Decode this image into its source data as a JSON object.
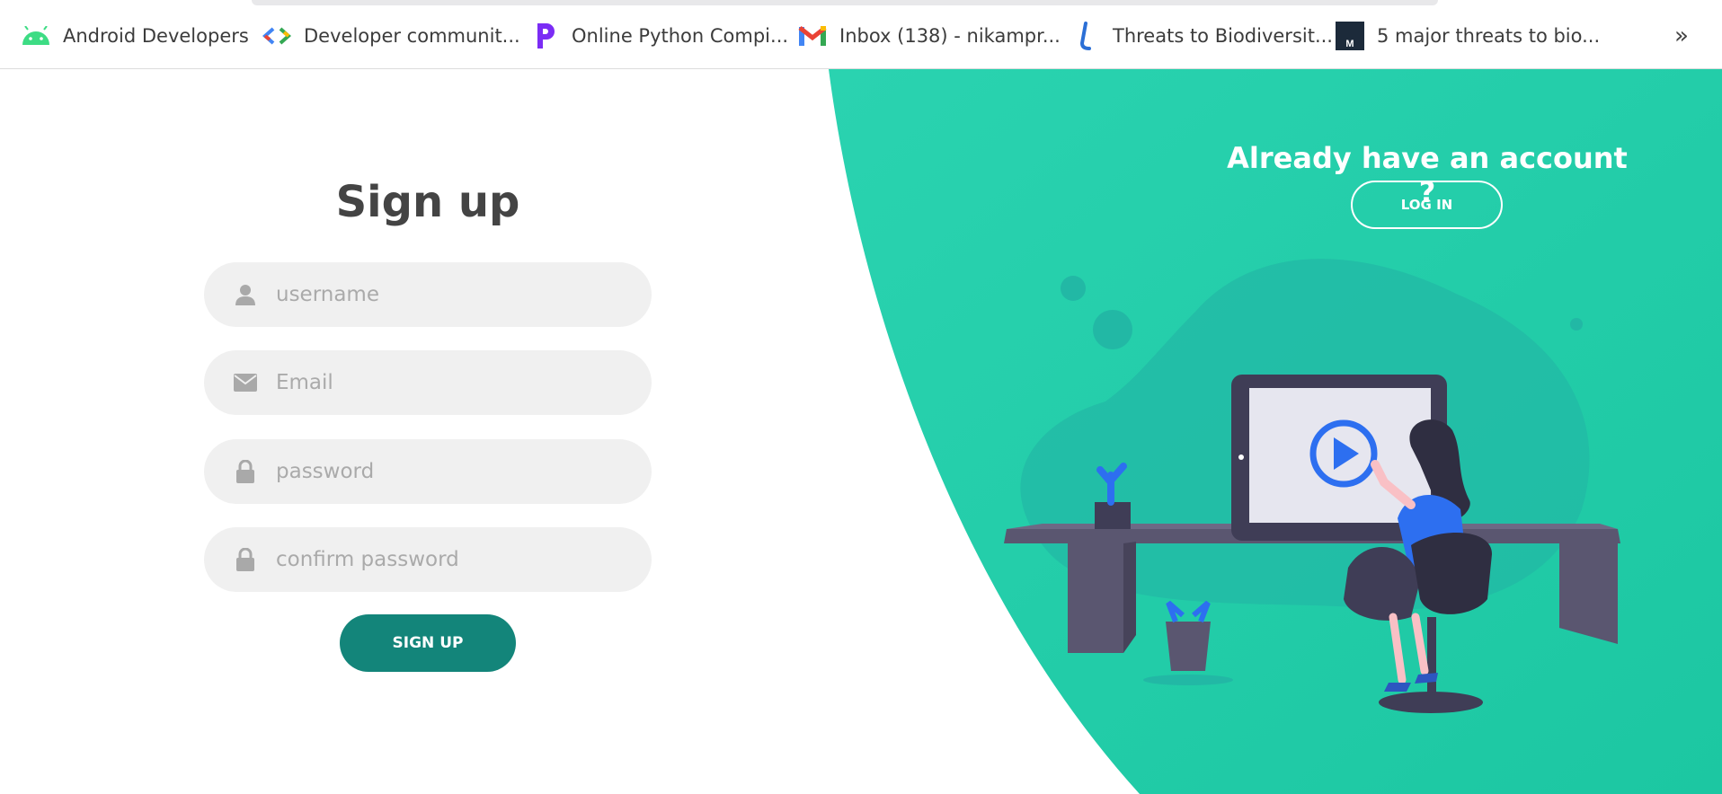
{
  "bookmarks": [
    {
      "label": "Android Developers",
      "icon": "android-icon"
    },
    {
      "label": "Developer communit...",
      "icon": "google-developers-icon"
    },
    {
      "label": "Online Python Compi...",
      "icon": "programiz-icon"
    },
    {
      "label": "Inbox (138) - nikampr...",
      "icon": "gmail-icon"
    },
    {
      "label": "Threats to Biodiversit...",
      "icon": "site-icon"
    },
    {
      "label": "5 major threats to bio...",
      "icon": "medium-icon"
    }
  ],
  "bookmarks_more": "»",
  "signup": {
    "title": "Sign up",
    "fields": [
      {
        "placeholder": "username",
        "icon": "user-icon"
      },
      {
        "placeholder": "Email",
        "icon": "envelope-icon"
      },
      {
        "placeholder": "password",
        "icon": "lock-icon"
      },
      {
        "placeholder": "confirm password",
        "icon": "lock-icon"
      }
    ],
    "button": "SIGN UP"
  },
  "panel": {
    "heading": "Already have an account ?",
    "login_button": "LOG IN"
  },
  "colors": {
    "panel_gradient_start": "#2ad3b0",
    "panel_gradient_end": "#1cc7a2",
    "signup_button": "#13857a",
    "field_bg": "#f0f0f0"
  }
}
